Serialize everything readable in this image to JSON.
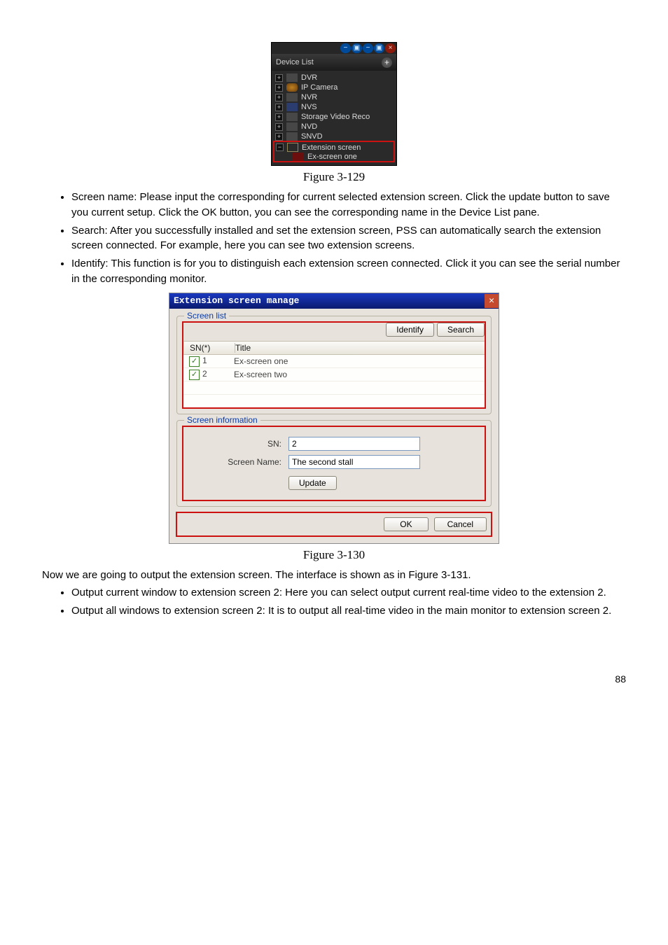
{
  "deviceListPanel": {
    "headerLabel": "Device List",
    "titlebar": {
      "icons": [
        "minimize-icon",
        "restore-icon",
        "collapse-icon",
        "expand-icon",
        "close-icon"
      ]
    },
    "items": [
      {
        "label": "DVR"
      },
      {
        "label": "IP Camera"
      },
      {
        "label": "NVR"
      },
      {
        "label": "NVS"
      },
      {
        "label": "Storage Video Reco"
      },
      {
        "label": "NVD"
      },
      {
        "label": "SNVD"
      },
      {
        "label": "Extension screen",
        "children": [
          {
            "label": "Ex-screen one"
          }
        ]
      }
    ]
  },
  "captions": {
    "fig1": "Figure 3-129",
    "fig2": "Figure 3-130"
  },
  "bulletsTop": [
    "Screen name: Please input the corresponding for current selected extension screen. Click the update button to save you current setup. Click the OK button, you can see the corresponding name in the Device List pane.",
    "Search: After you successfully installed and set the extension screen, PSS can automatically search the extension screen connected. For example, here you can see two extension screens.",
    "Identify: This function is for you to distinguish each extension screen connected. Click it you can see the serial number in the corresponding monitor."
  ],
  "dialog": {
    "title": "Extension screen manage",
    "groups": {
      "screenList": {
        "legend": "Screen list",
        "identifyBtn": "Identify",
        "searchBtn": "Search",
        "columns": {
          "sn": "SN(*)",
          "title": "Title"
        },
        "rows": [
          {
            "sn": "1",
            "title": "Ex-screen one",
            "checked": true
          },
          {
            "sn": "2",
            "title": "Ex-screen two",
            "checked": true
          }
        ]
      },
      "screenInfo": {
        "legend": "Screen information",
        "snLabel": "SN:",
        "snValue": "2",
        "nameLabel": "Screen Name:",
        "nameValue": "The second stall",
        "updateBtn": "Update"
      }
    },
    "okBtn": "OK",
    "cancelBtn": "Cancel"
  },
  "paraAfterDlg": "Now we are going to output the extension screen. The interface is shown as in Figure 3-131.",
  "bulletsBottom": [
    "Output current window to extension screen 2: Here you can select output current real-time video to the extension 2.",
    "Output all windows to extension screen 2: It is to output all real-time video in the main monitor to extension screen 2."
  ],
  "pageNumber": "88"
}
